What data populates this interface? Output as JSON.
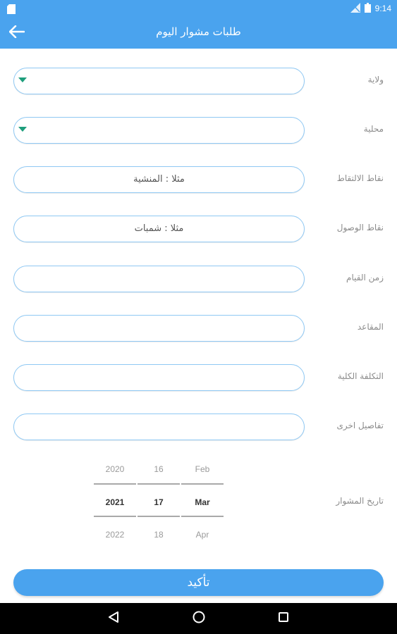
{
  "status_bar": {
    "time": "9:14",
    "icons": [
      "sd-card-icon",
      "no-sim-icon",
      "battery-icon"
    ]
  },
  "app_bar": {
    "title": "طلبات مشوار اليوم",
    "back_icon": "arrow-left-icon"
  },
  "form": {
    "fields": [
      {
        "label": "ولاية",
        "value": "",
        "placeholder": "",
        "type": "dropdown"
      },
      {
        "label": "محلية",
        "value": "",
        "placeholder": "",
        "type": "dropdown"
      },
      {
        "label": "نقاط الالتقاط",
        "value": "",
        "placeholder": "مثلا : المنشية",
        "type": "text"
      },
      {
        "label": "نقاط الوصول",
        "value": "",
        "placeholder": "مثلا : شمبات",
        "type": "text"
      },
      {
        "label": "زمن القيام",
        "value": "",
        "placeholder": "",
        "type": "text"
      },
      {
        "label": "المقاعد",
        "value": "",
        "placeholder": "",
        "type": "text"
      },
      {
        "label": "التكلفة الكلية",
        "value": "",
        "placeholder": "",
        "type": "text"
      },
      {
        "label": "تفاصيل اخرى",
        "value": "",
        "placeholder": "",
        "type": "text"
      }
    ]
  },
  "date_picker": {
    "label": "تاريخ المشوار",
    "year": {
      "prev": "2020",
      "selected": "2021",
      "next": "2022"
    },
    "day": {
      "prev": "16",
      "selected": "17",
      "next": "18"
    },
    "month": {
      "prev": "Feb",
      "selected": "Mar",
      "next": "Apr"
    }
  },
  "confirm_label": "تأكيد",
  "colors": {
    "primary": "#4aa3ee",
    "field_border": "#8fc8f3",
    "dropdown_caret": "#1e9e7c"
  }
}
